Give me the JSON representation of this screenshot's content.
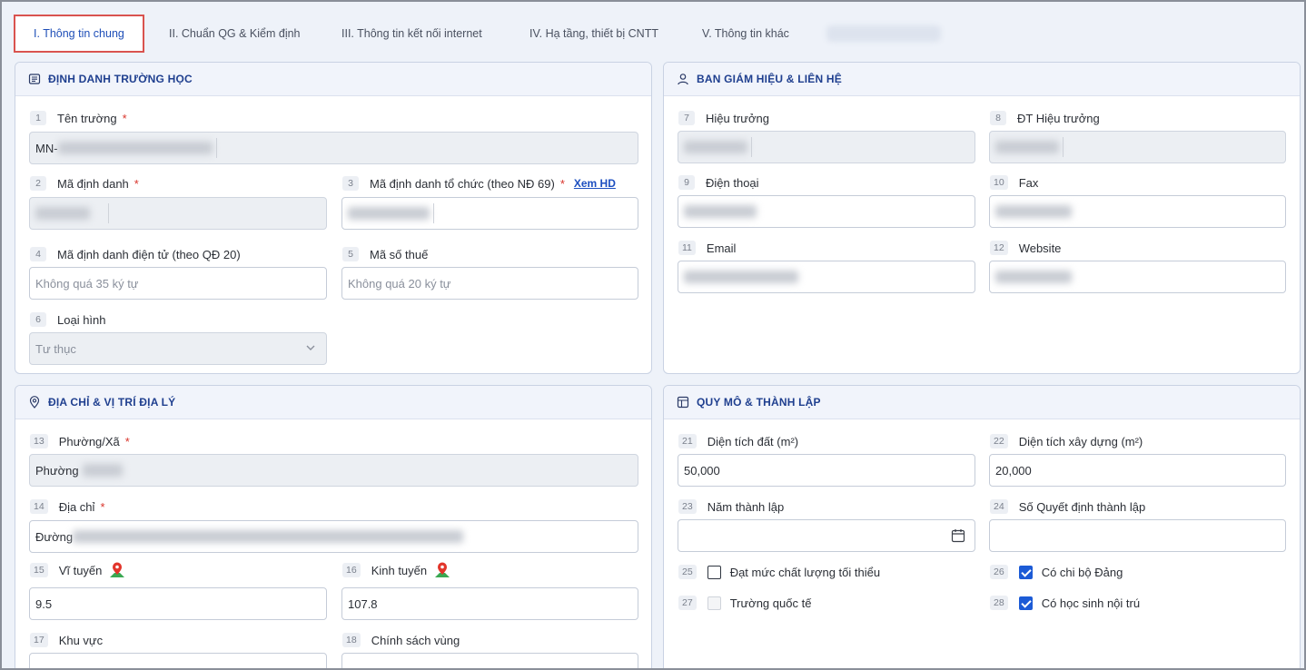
{
  "tabs": [
    {
      "label": "I. Thông tin chung"
    },
    {
      "label": "II. Chuẩn QG & Kiểm định"
    },
    {
      "label": "III. Thông tin kết nối internet"
    },
    {
      "label": "IV. Hạ tầng, thiết bị CNTT"
    },
    {
      "label": "V. Thông tin khác"
    }
  ],
  "colors": {
    "accent": "#1f4fb8",
    "required": "#d9342b",
    "active_tab_border": "#d9534f",
    "checkbox": "#1c5bd6"
  },
  "identity": {
    "title": "ĐỊNH DANH TRƯỜNG HỌC",
    "icon": "list-icon",
    "f1": {
      "num": "1",
      "label": "Tên trường",
      "value": "MN-"
    },
    "f2": {
      "num": "2",
      "label": "Mã định danh"
    },
    "f3": {
      "num": "3",
      "label": "Mã định danh tổ chức (theo NĐ 69)",
      "link": "Xem HD"
    },
    "f4": {
      "num": "4",
      "label": "Mã định danh điện tử (theo QĐ 20)",
      "placeholder": "Không quá 35 ký tự"
    },
    "f5": {
      "num": "5",
      "label": "Mã số thuế",
      "placeholder": "Không quá 20 ký tự"
    },
    "f6": {
      "num": "6",
      "label": "Loại hình",
      "value": "Tư thục"
    }
  },
  "board": {
    "title": "BAN GIÁM HIỆU & LIÊN HỆ",
    "icon": "user-icon",
    "f7": {
      "num": "7",
      "label": "Hiệu trưởng"
    },
    "f8": {
      "num": "8",
      "label": "ĐT Hiệu trưởng"
    },
    "f9": {
      "num": "9",
      "label": "Điện thoại"
    },
    "f10": {
      "num": "10",
      "label": "Fax"
    },
    "f11": {
      "num": "11",
      "label": "Email"
    },
    "f12": {
      "num": "12",
      "label": "Website"
    }
  },
  "address": {
    "title": "ĐỊA CHỈ & VỊ TRÍ ĐỊA LÝ",
    "icon": "location-pin-icon",
    "f13": {
      "num": "13",
      "label": "Phường/Xã",
      "value": "Phường"
    },
    "f14": {
      "num": "14",
      "label": "Địa chỉ",
      "value": "Đường"
    },
    "f15": {
      "num": "15",
      "label": "Vĩ tuyến",
      "value": "9.5"
    },
    "f16": {
      "num": "16",
      "label": "Kinh tuyến",
      "value": "107.8"
    },
    "f17": {
      "num": "17",
      "label": "Khu vực"
    },
    "f18": {
      "num": "18",
      "label": "Chính sách vùng"
    }
  },
  "scale": {
    "title": "QUY MÔ & THÀNH LẬP",
    "icon": "layout-icon",
    "f21": {
      "num": "21",
      "label": "Diện tích đất (m²)",
      "value": "50,000"
    },
    "f22": {
      "num": "22",
      "label": "Diện tích xây dựng (m²)",
      "value": "20,000"
    },
    "f23": {
      "num": "23",
      "label": "Năm thành lập"
    },
    "f24": {
      "num": "24",
      "label": "Số Quyết định thành lập"
    },
    "f25": {
      "num": "25",
      "label": "Đạt mức chất lượng tối thiểu",
      "checked": false
    },
    "f26": {
      "num": "26",
      "label": "Có chi bộ Đảng",
      "checked": true
    },
    "f27": {
      "num": "27",
      "label": "Trường quốc tế",
      "checked": false
    },
    "f28": {
      "num": "28",
      "label": "Có học sinh nội trú",
      "checked": true
    }
  }
}
